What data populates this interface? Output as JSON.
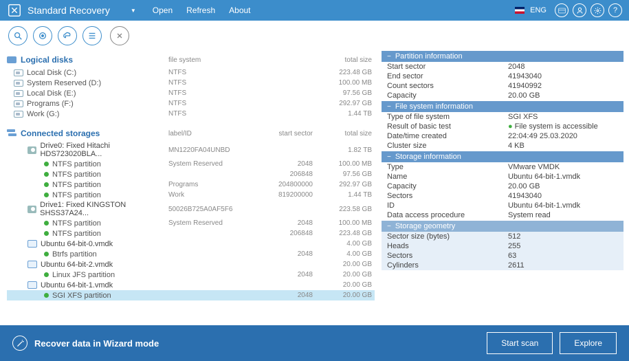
{
  "header": {
    "title": "Standard Recovery",
    "menu": {
      "open": "Open",
      "refresh": "Refresh",
      "about": "About"
    },
    "lang": "ENG"
  },
  "sections": {
    "logical": {
      "title": "Logical disks",
      "col_fs": "file system",
      "col_ts": "total size"
    },
    "storages": {
      "title": "Connected storages",
      "col_label": "label/ID",
      "col_ss": "start sector",
      "col_ts": "total size"
    }
  },
  "logical_disks": [
    {
      "name": "Local Disk (C:)",
      "fs": "NTFS",
      "size": "223.48 GB"
    },
    {
      "name": "System Reserved (D:)",
      "fs": "NTFS",
      "size": "100.00 MB"
    },
    {
      "name": "Local Disk (E:)",
      "fs": "NTFS",
      "size": "97.56 GB"
    },
    {
      "name": "Programs (F:)",
      "fs": "NTFS",
      "size": "292.97 GB"
    },
    {
      "name": "Work (G:)",
      "fs": "NTFS",
      "size": "1.44 TB"
    }
  ],
  "storages": [
    {
      "type": "drive",
      "name": "Drive0: Fixed Hitachi HDS723020BLA...",
      "label": "MN1220FA04UNBD",
      "ss": "",
      "size": "1.82 TB"
    },
    {
      "type": "part",
      "name": "NTFS partition",
      "label": "System Reserved",
      "ss": "2048",
      "size": "100.00 MB"
    },
    {
      "type": "part",
      "name": "NTFS partition",
      "label": "",
      "ss": "206848",
      "size": "97.56 GB"
    },
    {
      "type": "part",
      "name": "NTFS partition",
      "label": "Programs",
      "ss": "204800000",
      "size": "292.97 GB"
    },
    {
      "type": "part",
      "name": "NTFS partition",
      "label": "Work",
      "ss": "819200000",
      "size": "1.44 TB"
    },
    {
      "type": "drive",
      "name": "Drive1: Fixed KINGSTON SHSS37A24...",
      "label": "50026B725A0AF5F6",
      "ss": "",
      "size": "223.58 GB"
    },
    {
      "type": "part",
      "name": "NTFS partition",
      "label": "System Reserved",
      "ss": "2048",
      "size": "100.00 MB"
    },
    {
      "type": "part",
      "name": "NTFS partition",
      "label": "",
      "ss": "206848",
      "size": "223.48 GB"
    },
    {
      "type": "vdisk",
      "name": "Ubuntu 64-bit-0.vmdk",
      "label": "",
      "ss": "",
      "size": "4.00 GB"
    },
    {
      "type": "part",
      "name": "Btrfs partition",
      "label": "",
      "ss": "2048",
      "size": "4.00 GB"
    },
    {
      "type": "vdisk",
      "name": "Ubuntu 64-bit-2.vmdk",
      "label": "",
      "ss": "",
      "size": "20.00 GB"
    },
    {
      "type": "part",
      "name": "Linux JFS partition",
      "label": "",
      "ss": "2048",
      "size": "20.00 GB"
    },
    {
      "type": "vdisk",
      "name": "Ubuntu 64-bit-1.vmdk",
      "label": "",
      "ss": "",
      "size": "20.00 GB"
    },
    {
      "type": "part",
      "name": "SGI XFS partition",
      "label": "",
      "ss": "2048",
      "size": "20.00 GB",
      "selected": true
    }
  ],
  "info": {
    "partition": {
      "title": "Partition information",
      "rows": [
        {
          "k": "Start sector",
          "v": "2048"
        },
        {
          "k": "End sector",
          "v": "41943040"
        },
        {
          "k": "Count sectors",
          "v": "41940992"
        },
        {
          "k": "Capacity",
          "v": "20.00 GB"
        }
      ]
    },
    "filesystem": {
      "title": "File system information",
      "rows": [
        {
          "k": "Type of file system",
          "v": "SGI XFS"
        },
        {
          "k": "Result of basic test",
          "v": "File system is accessible",
          "ok": true
        },
        {
          "k": "Date/time created",
          "v": "22:04:49 25.03.2020"
        },
        {
          "k": "Cluster size",
          "v": "4 KB"
        }
      ]
    },
    "storage": {
      "title": "Storage information",
      "rows": [
        {
          "k": "Type",
          "v": "VMware VMDK"
        },
        {
          "k": "Name",
          "v": "Ubuntu 64-bit-1.vmdk"
        },
        {
          "k": "Capacity",
          "v": "20.00 GB"
        },
        {
          "k": "Sectors",
          "v": "41943040"
        },
        {
          "k": "ID",
          "v": "Ubuntu 64-bit-1.vmdk"
        },
        {
          "k": "Data access procedure",
          "v": "System read"
        }
      ]
    },
    "geometry": {
      "title": "Storage geometry",
      "rows": [
        {
          "k": "Sector size (bytes)",
          "v": "512"
        },
        {
          "k": "Heads",
          "v": "255"
        },
        {
          "k": "Sectors",
          "v": "63"
        },
        {
          "k": "Cylinders",
          "v": "2611"
        }
      ]
    }
  },
  "footer": {
    "wizard": "Recover data in Wizard mode",
    "scan": "Start scan",
    "explore": "Explore"
  }
}
